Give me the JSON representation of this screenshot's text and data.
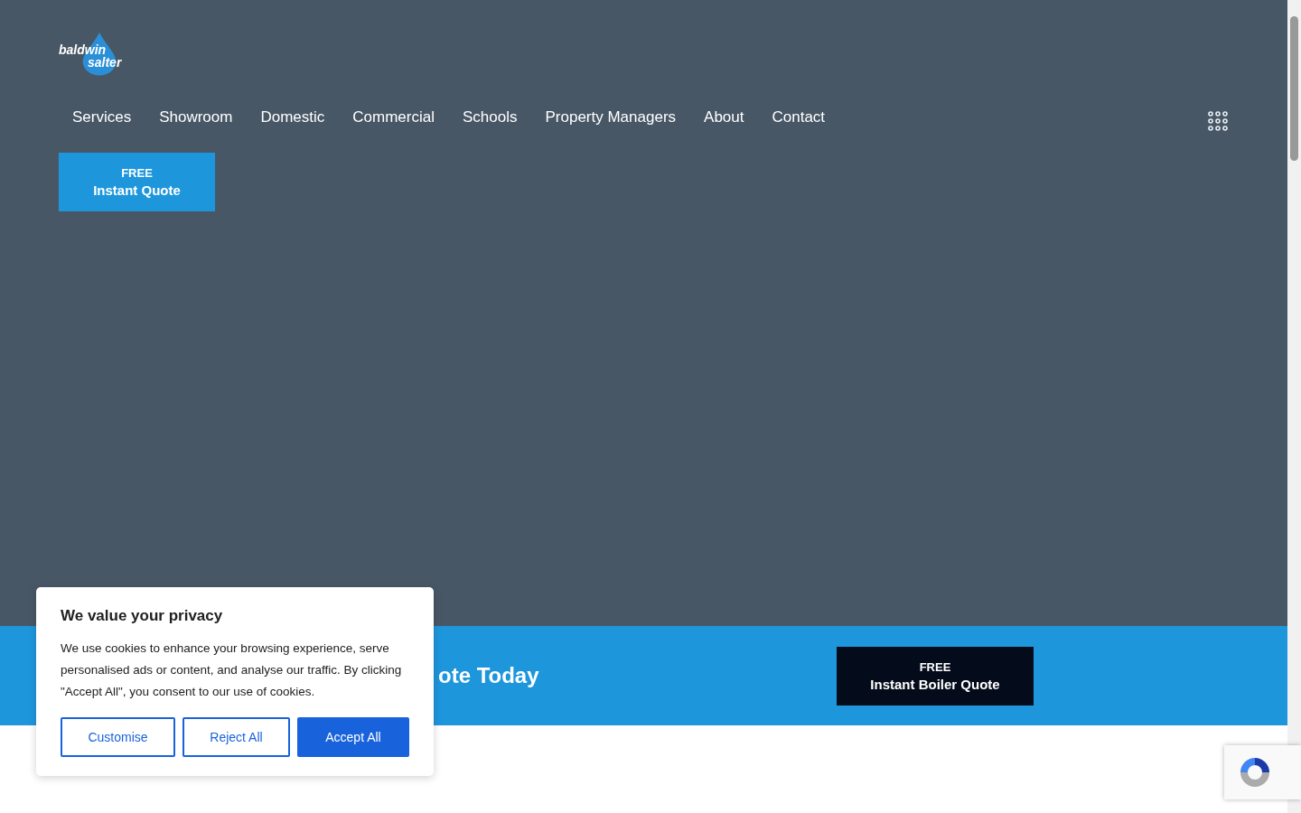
{
  "logo": {
    "line_1": "baldwin",
    "line_2": "salter"
  },
  "nav": {
    "items": [
      {
        "label": "Services"
      },
      {
        "label": "Showroom"
      },
      {
        "label": "Domestic"
      },
      {
        "label": "Commercial"
      },
      {
        "label": "Schools"
      },
      {
        "label": "Property Managers"
      },
      {
        "label": "About"
      },
      {
        "label": "Contact"
      }
    ]
  },
  "header_button": {
    "line_1": "FREE",
    "line_2": "Instant Quote"
  },
  "banner": {
    "heading": "ote Today",
    "button": {
      "line_1": "FREE",
      "line_2": "Instant Boiler Quote"
    }
  },
  "cookie_dialog": {
    "title": "We value your privacy",
    "text": "We use cookies to enhance your browsing experience, serve personalised ads or content, and analyse our traffic. By clicking \"Accept All\", you consent to our use of cookies.",
    "buttons": [
      {
        "label": "Customise",
        "kind": "outline"
      },
      {
        "label": "Reject All",
        "kind": "outline"
      },
      {
        "label": "Accept All",
        "kind": "filled"
      }
    ]
  }
}
